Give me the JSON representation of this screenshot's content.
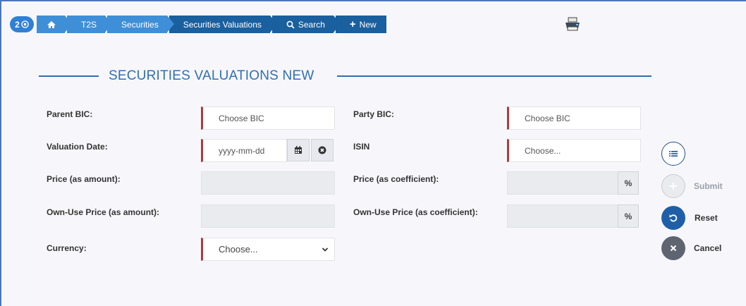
{
  "breadcrumb": {
    "badge": "2",
    "items": [
      "T2S",
      "Securities",
      "Securities Valuations",
      "Search",
      "New"
    ]
  },
  "page_title": "SECURITIES VALUATIONS NEW",
  "form": {
    "parent_bic": {
      "label": "Parent BIC:",
      "placeholder": "Choose BIC"
    },
    "party_bic": {
      "label": "Party BIC:",
      "placeholder": "Choose BIC"
    },
    "valuation_date": {
      "label": "Valuation Date:",
      "placeholder": "yyyy-mm-dd"
    },
    "isin": {
      "label": "ISIN",
      "placeholder": "Choose..."
    },
    "price_amount": {
      "label": "Price (as amount):"
    },
    "price_coefficient": {
      "label": "Price (as coefficient):",
      "suffix": "%"
    },
    "own_use_amount": {
      "label": "Own-Use Price (as amount):"
    },
    "own_use_coefficient": {
      "label": "Own-Use Price (as coefficient):",
      "suffix": "%"
    },
    "currency": {
      "label": "Currency:",
      "selected": "Choose..."
    }
  },
  "actions": {
    "submit": "Submit",
    "reset": "Reset",
    "cancel": "Cancel"
  },
  "colors": {
    "accent": "#2f6fb5",
    "breadcrumb": "#3f8fd8",
    "required": "#b03a3a",
    "reset": "#1f5fa8",
    "cancel": "#5f6570"
  }
}
